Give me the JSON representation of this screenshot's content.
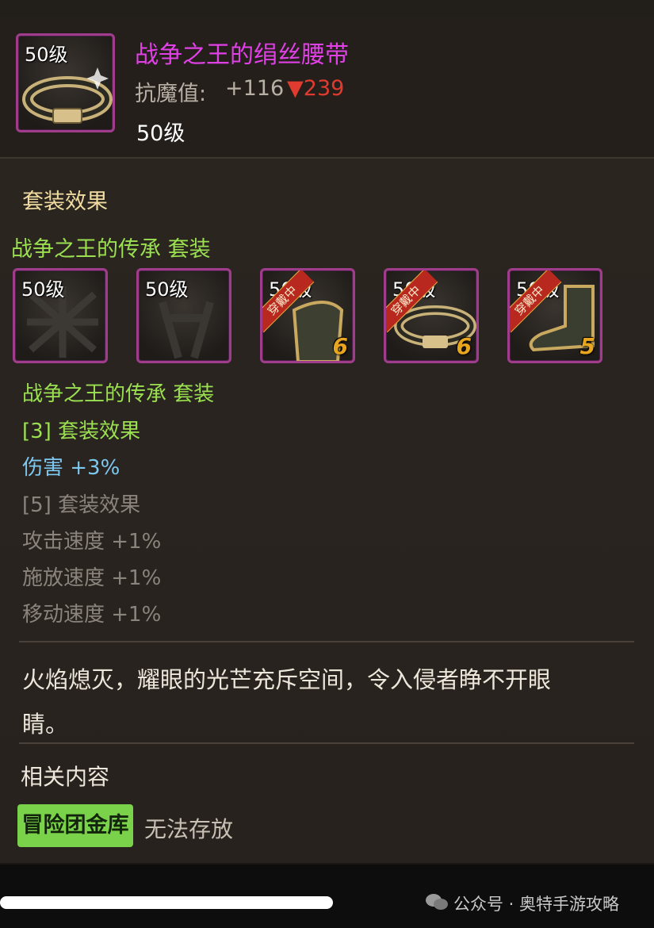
{
  "item": {
    "level_badge": "50级",
    "name": "战争之王的绢丝腰带",
    "resist_label": "抗魔值:",
    "resist_value": "+116",
    "resist_delta": "▼239",
    "level_text": "50级",
    "name_color": "#e040e6",
    "delta_color": "#e03b2f"
  },
  "set_section": {
    "header": "套装效果",
    "set_title": "战争之王的传承  套装",
    "slots": [
      {
        "level": "50级",
        "icon": "chest-armor-icon",
        "equipped": false,
        "count": ""
      },
      {
        "level": "50级",
        "icon": "leg-armor-icon",
        "equipped": false,
        "count": ""
      },
      {
        "level": "50级",
        "icon": "shoulder-armor-icon",
        "equipped": true,
        "ribbon": "穿戴中",
        "count": "6"
      },
      {
        "level": "50级",
        "icon": "belt-icon",
        "equipped": true,
        "ribbon": "穿戴中",
        "count": "6"
      },
      {
        "level": "50级",
        "icon": "boots-icon",
        "equipped": true,
        "ribbon": "穿戴中",
        "count": "5"
      }
    ],
    "set_title_2": "战争之王的传承  套装",
    "bonus3_label": "[3] 套装效果",
    "bonus3_effect": "伤害 +3%",
    "bonus5_label": "[5] 套装效果",
    "bonus5_effects": [
      "攻击速度 +1%",
      "施放速度 +1%",
      "移动速度 +1%"
    ]
  },
  "description": {
    "line1": "火焰熄灭，耀眼的光芒充斥空间，令入侵者睁不开眼",
    "line2": "睛。"
  },
  "related": {
    "header": "相关内容",
    "button": "冒险团金库",
    "status": "无法存放"
  },
  "watermark": {
    "text": "公众号 · 奥特手游攻略"
  }
}
